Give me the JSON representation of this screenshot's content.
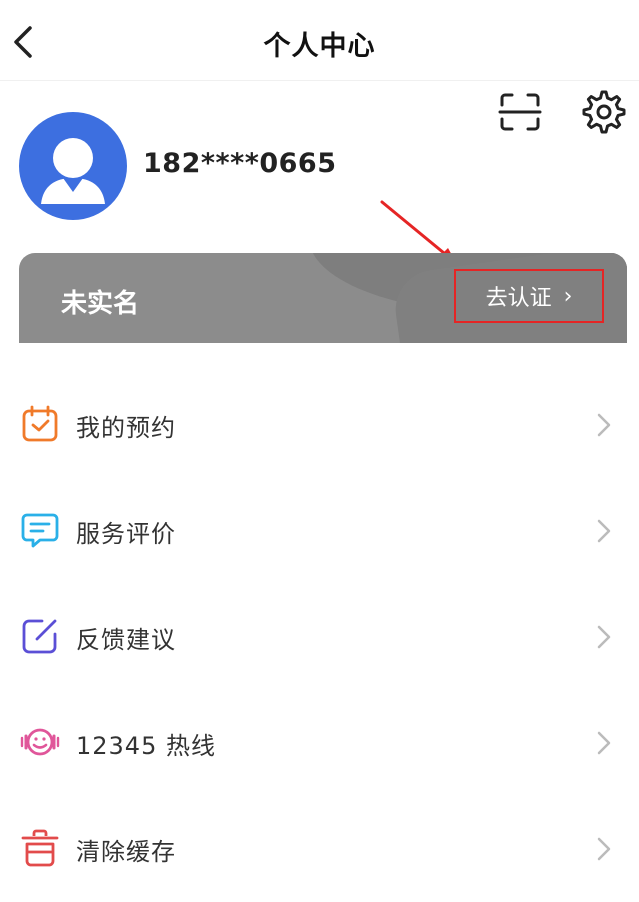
{
  "header": {
    "title": "个人中心"
  },
  "user": {
    "phone": "182****0665"
  },
  "verification": {
    "status": "未实名",
    "action_label": "去认证",
    "chevron": "›"
  },
  "menu": [
    {
      "label": "我的预约",
      "icon": "calendar-check-icon",
      "color": "#f07a2a"
    },
    {
      "label": "服务评价",
      "icon": "chat-bubble-icon",
      "color": "#2ab0e8"
    },
    {
      "label": "反馈建议",
      "icon": "edit-icon",
      "color": "#5b4fd6"
    },
    {
      "label": "12345 热线",
      "icon": "headset-icon",
      "color": "#e0569a"
    },
    {
      "label": "清除缓存",
      "icon": "trash-icon",
      "color": "#e24b4b"
    }
  ],
  "colors": {
    "avatar_bg": "#3d6fe0",
    "banner_bg": "#8c8c8c",
    "highlight": "#e52525"
  }
}
